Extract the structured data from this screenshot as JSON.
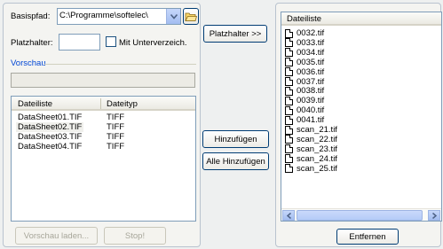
{
  "basispfad": {
    "label": "Basispfad:",
    "value": "C:\\Programme\\softelec\\"
  },
  "platzhalter": {
    "label": "Platzhalter:",
    "value": "",
    "checkbox_label": "Mit Unterverzeich."
  },
  "vorschau": {
    "group_label": "Vorschau",
    "value": ""
  },
  "left_list": {
    "col_name": "Dateiliste",
    "col_type": "Dateityp",
    "rows": [
      {
        "name": "DataSheet01.TIF",
        "type": "TIFF"
      },
      {
        "name": "DataSheet02.TIF",
        "type": "TIFF"
      },
      {
        "name": "DataSheet03.TIF",
        "type": "TIFF"
      },
      {
        "name": "DataSheet04.TIF",
        "type": "TIFF"
      }
    ]
  },
  "buttons": {
    "platzhalter": "Platzhalter >>",
    "hinzufuegen": "Hinzufügen",
    "alle_hinzufuegen": "Alle Hinzufügen",
    "vorschau_laden": "Vorschau laden...",
    "stop": "Stop!",
    "entfernen": "Entfernen"
  },
  "right_list": {
    "header": "Dateiliste",
    "files": [
      "0032.tif",
      "0033.tif",
      "0034.tif",
      "0035.tif",
      "0036.tif",
      "0037.tif",
      "0038.tif",
      "0039.tif",
      "0040.tif",
      "0041.tif",
      "scan_21.tif",
      "scan_22.tif",
      "scan_23.tif",
      "scan_24.tif",
      "scan_25.tif"
    ]
  }
}
